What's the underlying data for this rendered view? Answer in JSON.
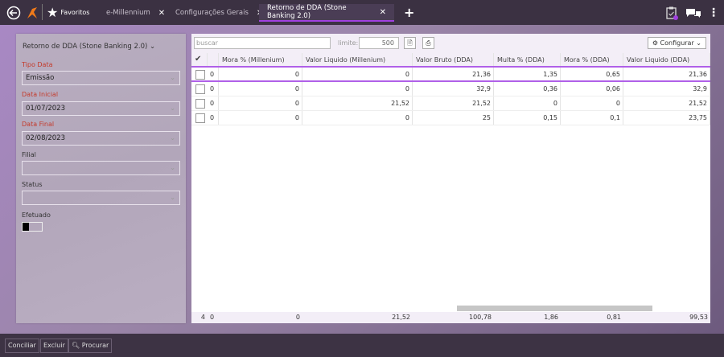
{
  "topbar": {
    "favorites": "Favoritos",
    "tabs": [
      {
        "label": "e-Millennium"
      },
      {
        "label": "Configurações Gerais"
      },
      {
        "label": "Retorno de DDA (Stone Banking 2.0)",
        "active": true
      }
    ]
  },
  "filters": {
    "title": "Retorno de DDA (Stone Banking 2.0)",
    "tipo_data_label": "Tipo Data",
    "tipo_data": "Emissão",
    "data_inicial_label": "Data Inicial",
    "data_inicial": "01/07/2023",
    "data_final_label": "Data Final",
    "data_final": "02/08/2023",
    "filial_label": "Filial",
    "filial": "",
    "status_label": "Status",
    "status": "",
    "efetuado_label": "Efetuado",
    "efetuado": false
  },
  "grid": {
    "search_placeholder": "buscar",
    "limit_label": "limite:",
    "limit": "500",
    "configure": "Configurar",
    "columns": [
      "",
      "Mora % (Millenium)",
      "Valor Liquido (Millenium)",
      "Valor Bruto (DDA)",
      "Multa % (DDA)",
      "Mora % (DDA)",
      "Valor Liquido (DDA)"
    ],
    "rows": [
      [
        "0",
        "0",
        "0",
        "21,36",
        "1,35",
        "0,65",
        "21,36"
      ],
      [
        "0",
        "0",
        "0",
        "32,9",
        "0,36",
        "0,06",
        "32,9"
      ],
      [
        "0",
        "0",
        "21,52",
        "21,52",
        "0",
        "0",
        "21,52"
      ],
      [
        "0",
        "0",
        "0",
        "25",
        "0,15",
        "0,1",
        "23,75"
      ]
    ],
    "footer": {
      "count": "4",
      "values": [
        "0",
        "0",
        "21,52",
        "100,78",
        "1,86",
        "0,81",
        "99,53"
      ]
    }
  },
  "actions": {
    "conciliar": "Conciliar",
    "excluir": "Excluir",
    "procurar": "Procurar"
  },
  "colors": {
    "accent": "#a040e0",
    "title_red": "#c43a2a"
  }
}
